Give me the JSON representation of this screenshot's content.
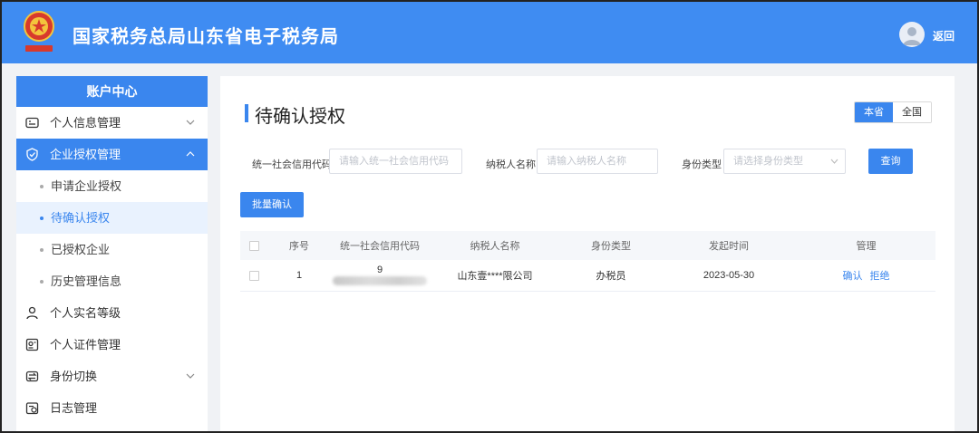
{
  "header": {
    "title": "国家税务总局山东省电子税务局",
    "back_label": "返回",
    "emblem_icon": "tax-emblem-icon",
    "avatar_icon": "user-avatar-icon",
    "brand_color": "#3f8cf2"
  },
  "sidebar": {
    "heading": "账户中心",
    "items": [
      {
        "label": "个人信息管理",
        "icon": "id-card-icon",
        "chevron": "down"
      },
      {
        "label": "企业授权管理",
        "icon": "shield-check-icon",
        "chevron": "up",
        "active": true
      },
      {
        "label": "申请企业授权"
      },
      {
        "label": "待确认授权",
        "current": true
      },
      {
        "label": "已授权企业"
      },
      {
        "label": "历史管理信息"
      },
      {
        "label": "个人实名等级",
        "icon": "user-badge-icon"
      },
      {
        "label": "个人证件管理",
        "icon": "certificate-icon"
      },
      {
        "label": "身份切换",
        "icon": "switch-icon",
        "chevron": "down"
      },
      {
        "label": "日志管理",
        "icon": "log-icon"
      }
    ]
  },
  "main": {
    "title": "待确认授权",
    "scope_options": [
      "本省",
      "全国"
    ],
    "scope_selected": "本省",
    "filters": {
      "credit_code_label": "统一社会信用代码",
      "credit_code_placeholder": "请输入统一社会信用代码",
      "taxpayer_label": "纳税人名称",
      "taxpayer_placeholder": "请输入纳税人名称",
      "identity_label": "身份类型",
      "identity_placeholder": "请选择身份类型",
      "query_label": "查询"
    },
    "batch_label": "批量确认",
    "table": {
      "headers": [
        "序号",
        "统一社会信用代码",
        "纳税人名称",
        "身份类型",
        "发起时间",
        "管理"
      ],
      "rows": [
        {
          "index": "1",
          "credit_code_visible": "9",
          "taxpayer": "山东壹****限公司",
          "identity": "办税员",
          "time": "2023-05-30",
          "actions": [
            "确认",
            "拒绝"
          ]
        }
      ]
    }
  }
}
